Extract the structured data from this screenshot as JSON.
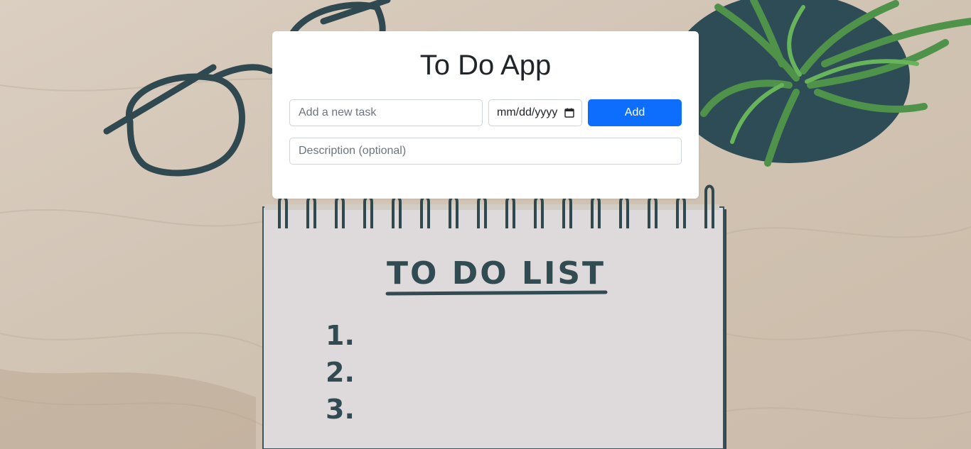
{
  "app": {
    "title": "To Do App"
  },
  "form": {
    "task_placeholder": "Add a new task",
    "date_placeholder": "mm/dd/yyyy",
    "date_icon": "calendar-icon",
    "add_label": "Add",
    "description_placeholder": "Description (optional)"
  },
  "background": {
    "notepad_heading": "TO DO LIST",
    "notepad_items": [
      "1.",
      "2.",
      "3."
    ]
  },
  "colors": {
    "primary": "#0d6efd",
    "card": "#ffffff",
    "ink": "#1f3c44"
  }
}
